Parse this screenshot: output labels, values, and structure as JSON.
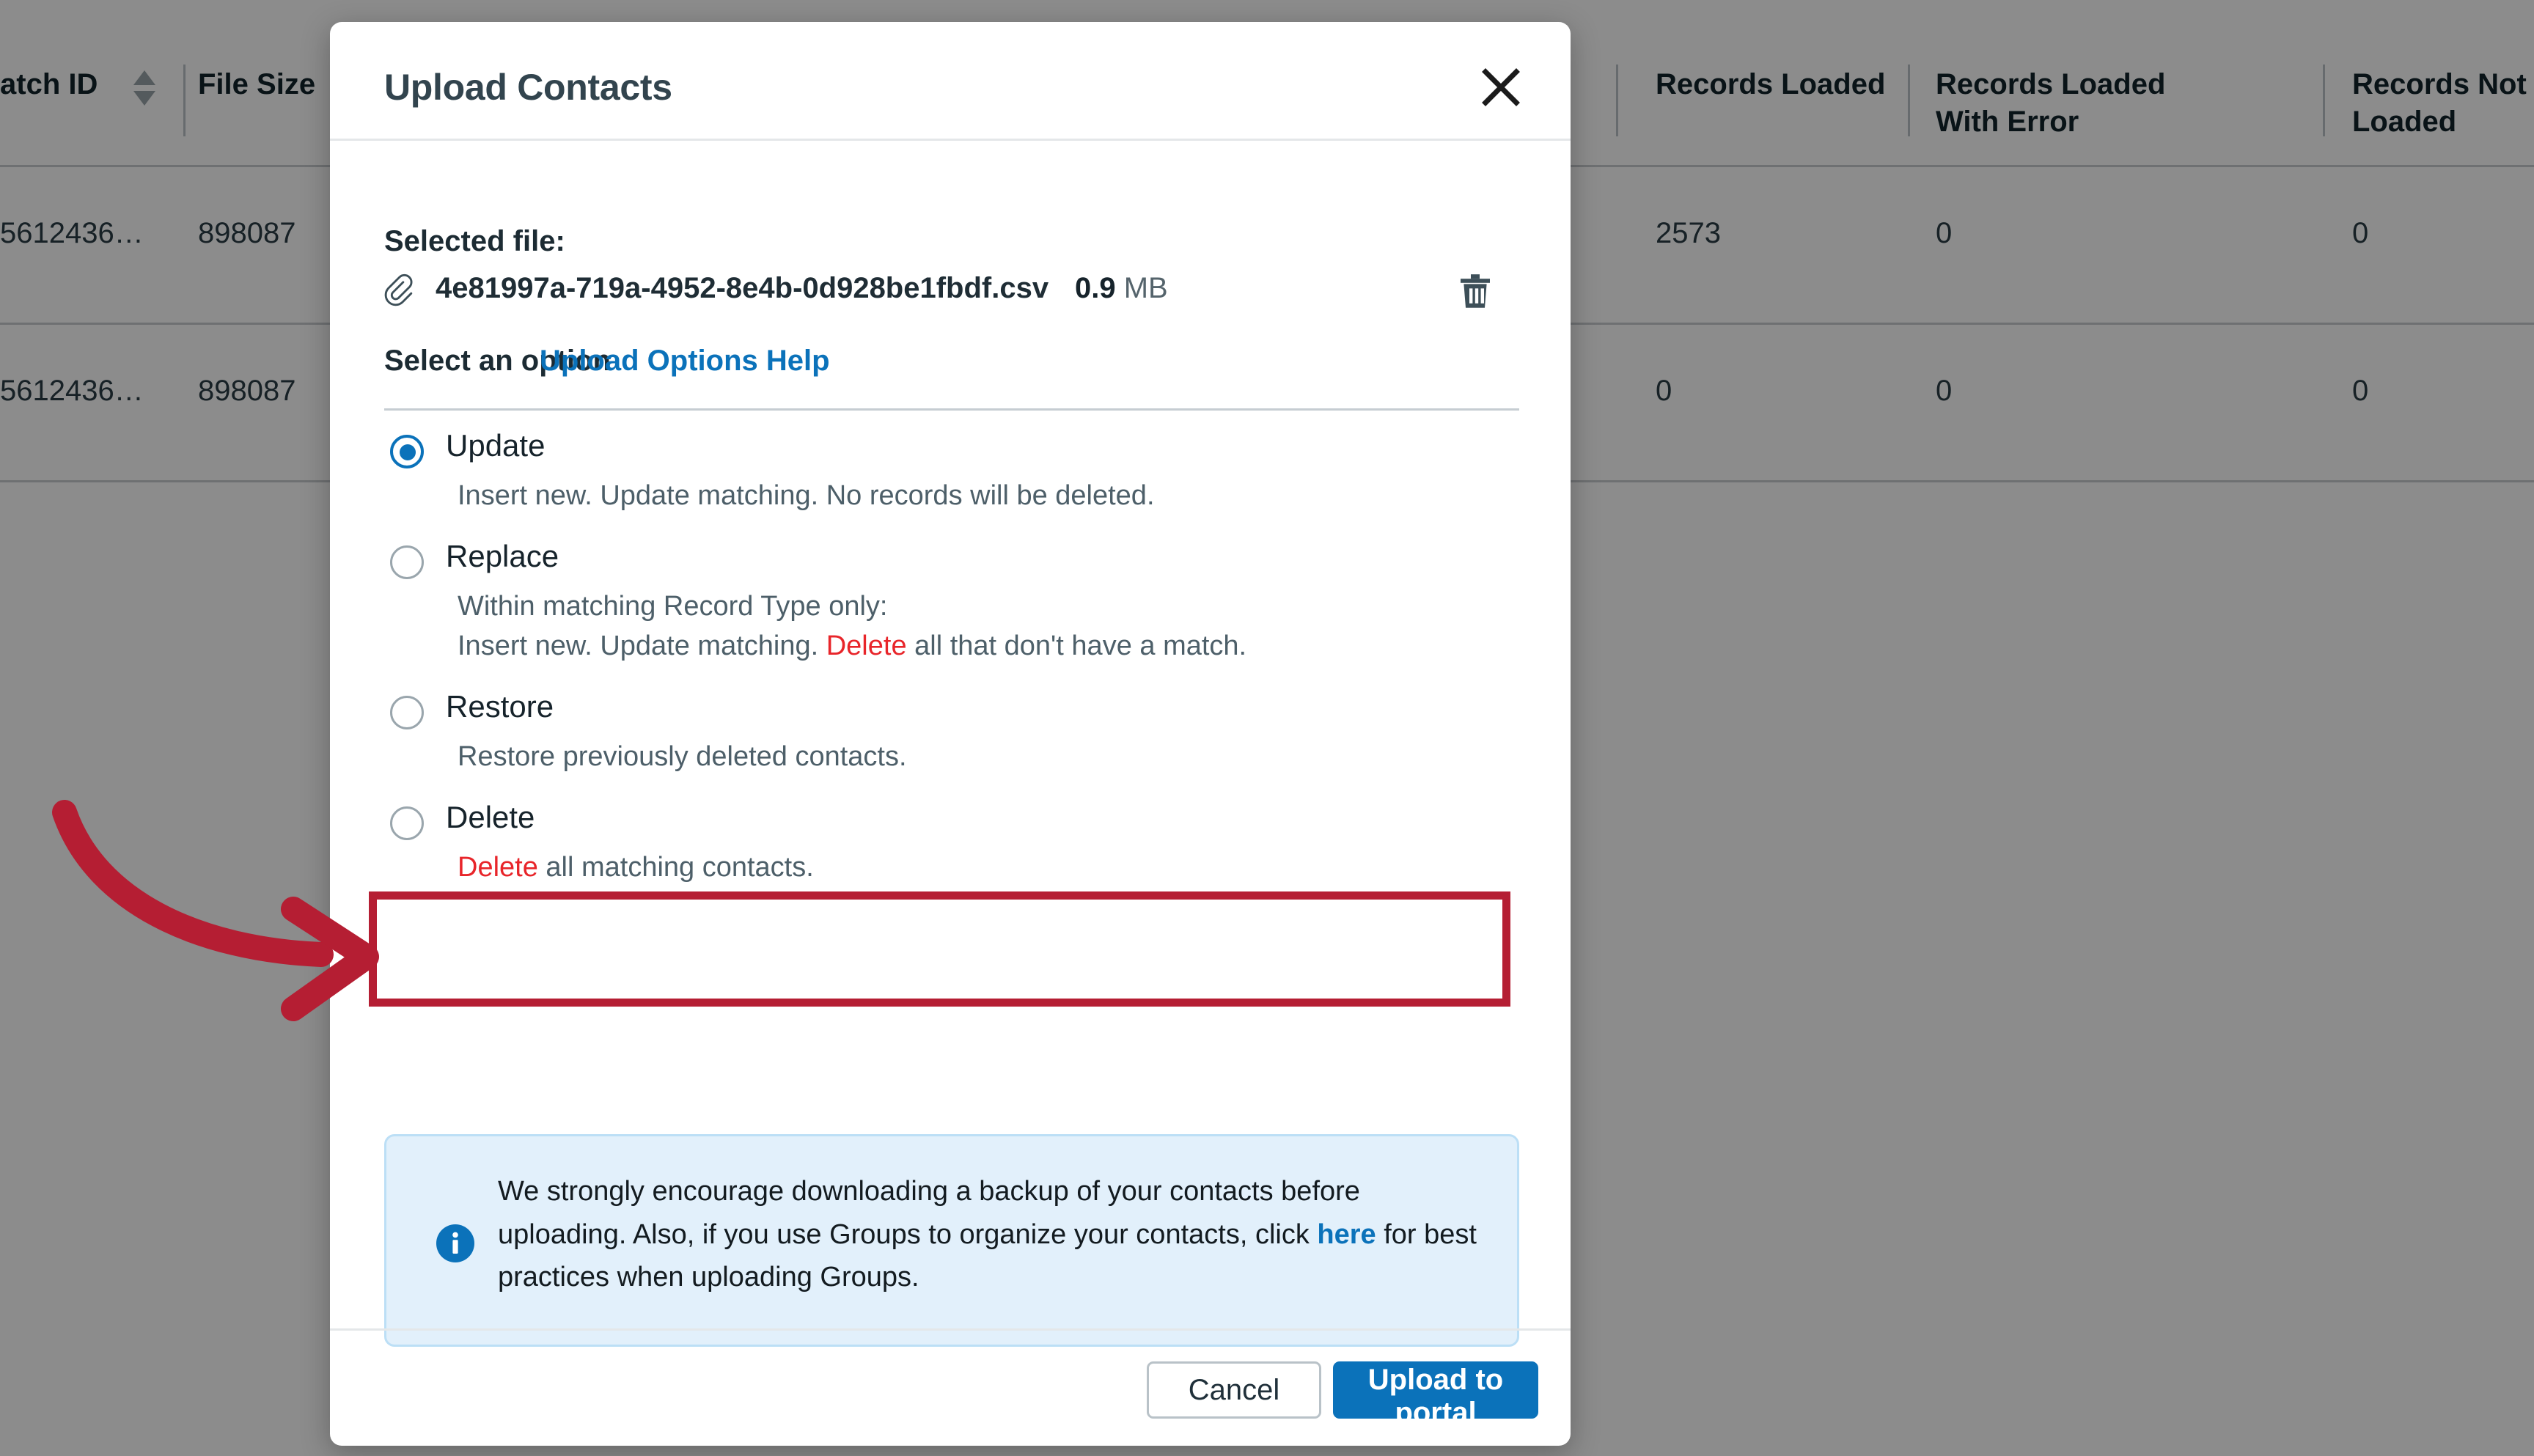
{
  "background_table": {
    "columns": [
      {
        "label": "atch ID",
        "sortable": true
      },
      {
        "label": "File Size",
        "sortable": false
      },
      {
        "label": "Records Loaded",
        "sortable": false
      },
      {
        "label": "Records Loaded With Error",
        "sortable": false
      },
      {
        "label": "Records Not Loaded",
        "sortable": false
      }
    ],
    "rows": [
      {
        "batch_id": "5612436…",
        "file_size": "898087",
        "records_loaded": "2573",
        "records_loaded_with_error": "0",
        "records_not_loaded": "0"
      },
      {
        "batch_id": "5612436…",
        "file_size": "898087",
        "records_loaded": "0",
        "records_loaded_with_error": "0",
        "records_not_loaded": "0"
      }
    ]
  },
  "modal": {
    "title": "Upload Contacts",
    "close_label": "close-icon",
    "selected_file_label": "Selected file:",
    "file": {
      "name": "4e81997a-719a-4952-8e4b-0d928be1fbdf.csv",
      "size_value": "0.9",
      "size_unit": "MB",
      "delete_label": "trash-icon"
    },
    "options_section": {
      "title": "Select an option",
      "help_link": "Upload Options Help"
    },
    "options": [
      {
        "id": "update",
        "label": "Update",
        "selected": true,
        "desc_lines": [
          [
            {
              "text": "Insert new. Update matching. No records will be deleted.",
              "style": "normal"
            }
          ]
        ]
      },
      {
        "id": "replace",
        "label": "Replace",
        "selected": false,
        "desc_lines": [
          [
            {
              "text": "Within matching Record Type only:",
              "style": "normal"
            }
          ],
          [
            {
              "text": "Insert new. Update matching. ",
              "style": "normal"
            },
            {
              "text": "Delete",
              "style": "danger"
            },
            {
              "text": " all that don't have a match.",
              "style": "normal"
            }
          ]
        ]
      },
      {
        "id": "restore",
        "label": "Restore",
        "selected": false,
        "desc_lines": [
          [
            {
              "text": "Restore previously deleted contacts.",
              "style": "normal"
            }
          ]
        ]
      },
      {
        "id": "delete",
        "label": "Delete",
        "selected": false,
        "highlighted": true,
        "desc_lines": [
          [
            {
              "text": "Delete",
              "style": "danger"
            },
            {
              "text": " all matching contacts.",
              "style": "normal"
            }
          ]
        ]
      }
    ],
    "info_notice": {
      "icon": "info-icon",
      "parts": [
        {
          "text": "We strongly encourage downloading a backup of your contacts before uploading. Also, if you use Groups to organize your contacts, click ",
          "style": "normal"
        },
        {
          "text": "here",
          "style": "link"
        },
        {
          "text": " for best practices when uploading Groups.",
          "style": "normal"
        }
      ]
    },
    "footer": {
      "cancel_label": "Cancel",
      "submit_label": "Upload to portal"
    }
  },
  "annotations": {
    "arrow": {
      "name": "red-arrow-annotation",
      "color": "#b51e33",
      "points_to": "delete"
    },
    "highlight_box": {
      "name": "red-highlight-box",
      "color": "#b51e33",
      "target": "delete"
    }
  },
  "colors": {
    "accent": "#0b72ba",
    "danger": "#e8252a",
    "annotation": "#b51e33",
    "info_bg": "#e2f0fb",
    "text": "#16232b"
  }
}
